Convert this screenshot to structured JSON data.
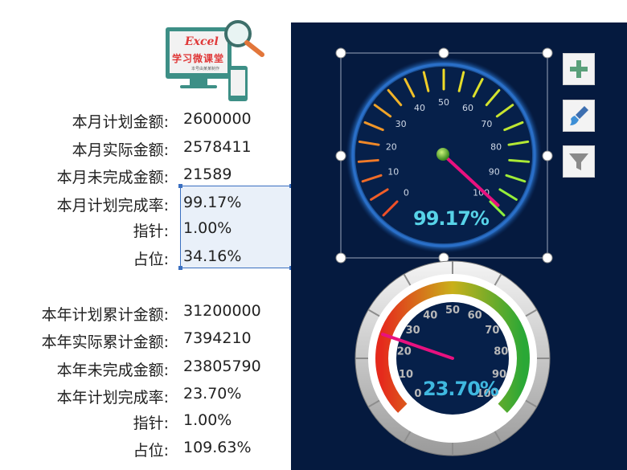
{
  "logo": {
    "title": "Excel",
    "subtitle": "学习微课堂",
    "tagline": "本号由某某制作"
  },
  "monthly": [
    {
      "label": "本月计划金额:",
      "value": "2600000"
    },
    {
      "label": "本月实际金额:",
      "value": "2578411"
    },
    {
      "label": "本月未完成金额:",
      "value": "21589"
    },
    {
      "label": "本月计划完成率:",
      "value": "99.17%"
    },
    {
      "label": "指针:",
      "value": "1.00%"
    },
    {
      "label": "占位:",
      "value": "34.16%"
    }
  ],
  "yearly": [
    {
      "label": "本年计划累计金额:",
      "value": "31200000"
    },
    {
      "label": "本年实际累计金额:",
      "value": "7394210"
    },
    {
      "label": "本年未完成金额:",
      "value": "23805790"
    },
    {
      "label": "本年计划完成率:",
      "value": "23.70%"
    },
    {
      "label": "指针:",
      "value": "1.00%"
    },
    {
      "label": "占位:",
      "value": "109.63%"
    }
  ],
  "gauge_month": {
    "value_text": "99.17%",
    "value": 99.17,
    "ticks": [
      "0",
      "10",
      "20",
      "30",
      "40",
      "50",
      "60",
      "70",
      "80",
      "90",
      "100"
    ]
  },
  "gauge_year": {
    "value_text": "23.70%",
    "value": 23.7,
    "ticks": [
      "0",
      "10",
      "20",
      "30",
      "40",
      "50",
      "60",
      "70",
      "80",
      "90",
      "100"
    ]
  },
  "tools": [
    {
      "icon": "plus-icon",
      "tooltip": "Chart Elements"
    },
    {
      "icon": "paintbrush-icon",
      "tooltip": "Chart Styles"
    },
    {
      "icon": "filter-icon",
      "tooltip": "Chart Filters"
    }
  ],
  "colors": {
    "panel": "#051a3f",
    "value_text": "#57d3e8",
    "needle": "#e8117f",
    "selection": "#3a6fc0"
  }
}
